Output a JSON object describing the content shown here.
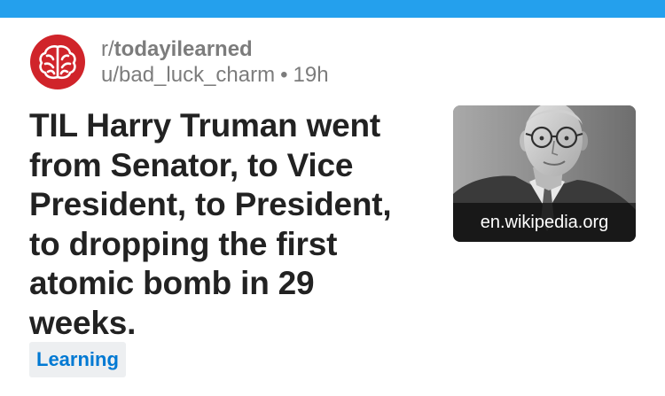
{
  "colors": {
    "top_bar": "#24a0ed",
    "subreddit_icon_bg": "#d0242a",
    "flair_bg": "#edeff1",
    "flair_text": "#0079d3",
    "meta_text": "#7c7c7c"
  },
  "post": {
    "subreddit": "todayilearned",
    "subreddit_prefix": "r/",
    "subreddit_icon": "brain-icon",
    "author": "u/bad_luck_charm",
    "separator": "•",
    "age": "19h",
    "title": "TIL Harry Truman went from Senator, to Vice President, to President, to dropping the first atomic bomb in 29 weeks.",
    "thumbnail": {
      "domain": "en.wikipedia.org"
    },
    "flair": "Learning"
  }
}
